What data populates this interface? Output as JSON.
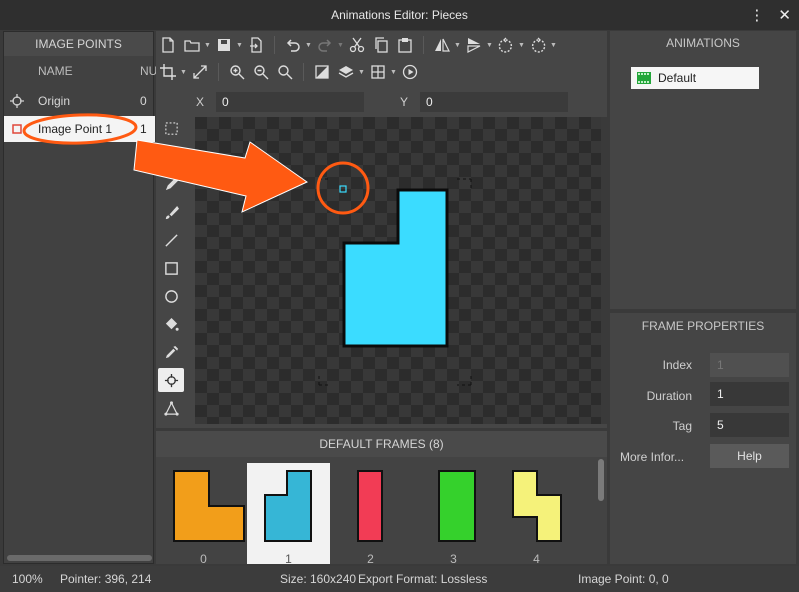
{
  "window": {
    "title": "Animations Editor: Pieces",
    "menu_icon": "kebab-menu-icon",
    "close_icon": "close-icon"
  },
  "image_points": {
    "title": "IMAGE POINTS",
    "col_name": "NAME",
    "col_num": "NU",
    "rows": [
      {
        "name": "Origin",
        "num": "0"
      },
      {
        "name": "Image Point 1",
        "num": "1"
      }
    ]
  },
  "coords": {
    "x_label": "X",
    "x_value": "0",
    "y_label": "Y",
    "y_value": "0"
  },
  "frames": {
    "title": "DEFAULT FRAMES (8)",
    "items": [
      {
        "num": "0",
        "color": "#f29e1a"
      },
      {
        "num": "1",
        "color": "#36b6d6"
      },
      {
        "num": "2",
        "color": "#f23c55"
      },
      {
        "num": "3",
        "color": "#35d12c"
      },
      {
        "num": "4",
        "color": "#f5f27a"
      }
    ]
  },
  "animations": {
    "title": "ANIMATIONS",
    "items": [
      {
        "name": "Default"
      }
    ]
  },
  "frame_properties": {
    "title": "FRAME PROPERTIES",
    "index_label": "Index",
    "index_value": "1",
    "duration_label": "Duration",
    "duration_value": "1",
    "tag_label": "Tag",
    "tag_value": "5",
    "more_label": "More Infor...",
    "help_label": "Help"
  },
  "status": {
    "zoom": "100%",
    "pointer": "Pointer: 396, 214",
    "size": "Size: 160x240",
    "export": "Export Format: Lossless",
    "image_point": "Image Point: 0, 0"
  },
  "colors": {
    "canvas_piece": "#3bdcff",
    "accent_arrow": "#ff5a12"
  }
}
